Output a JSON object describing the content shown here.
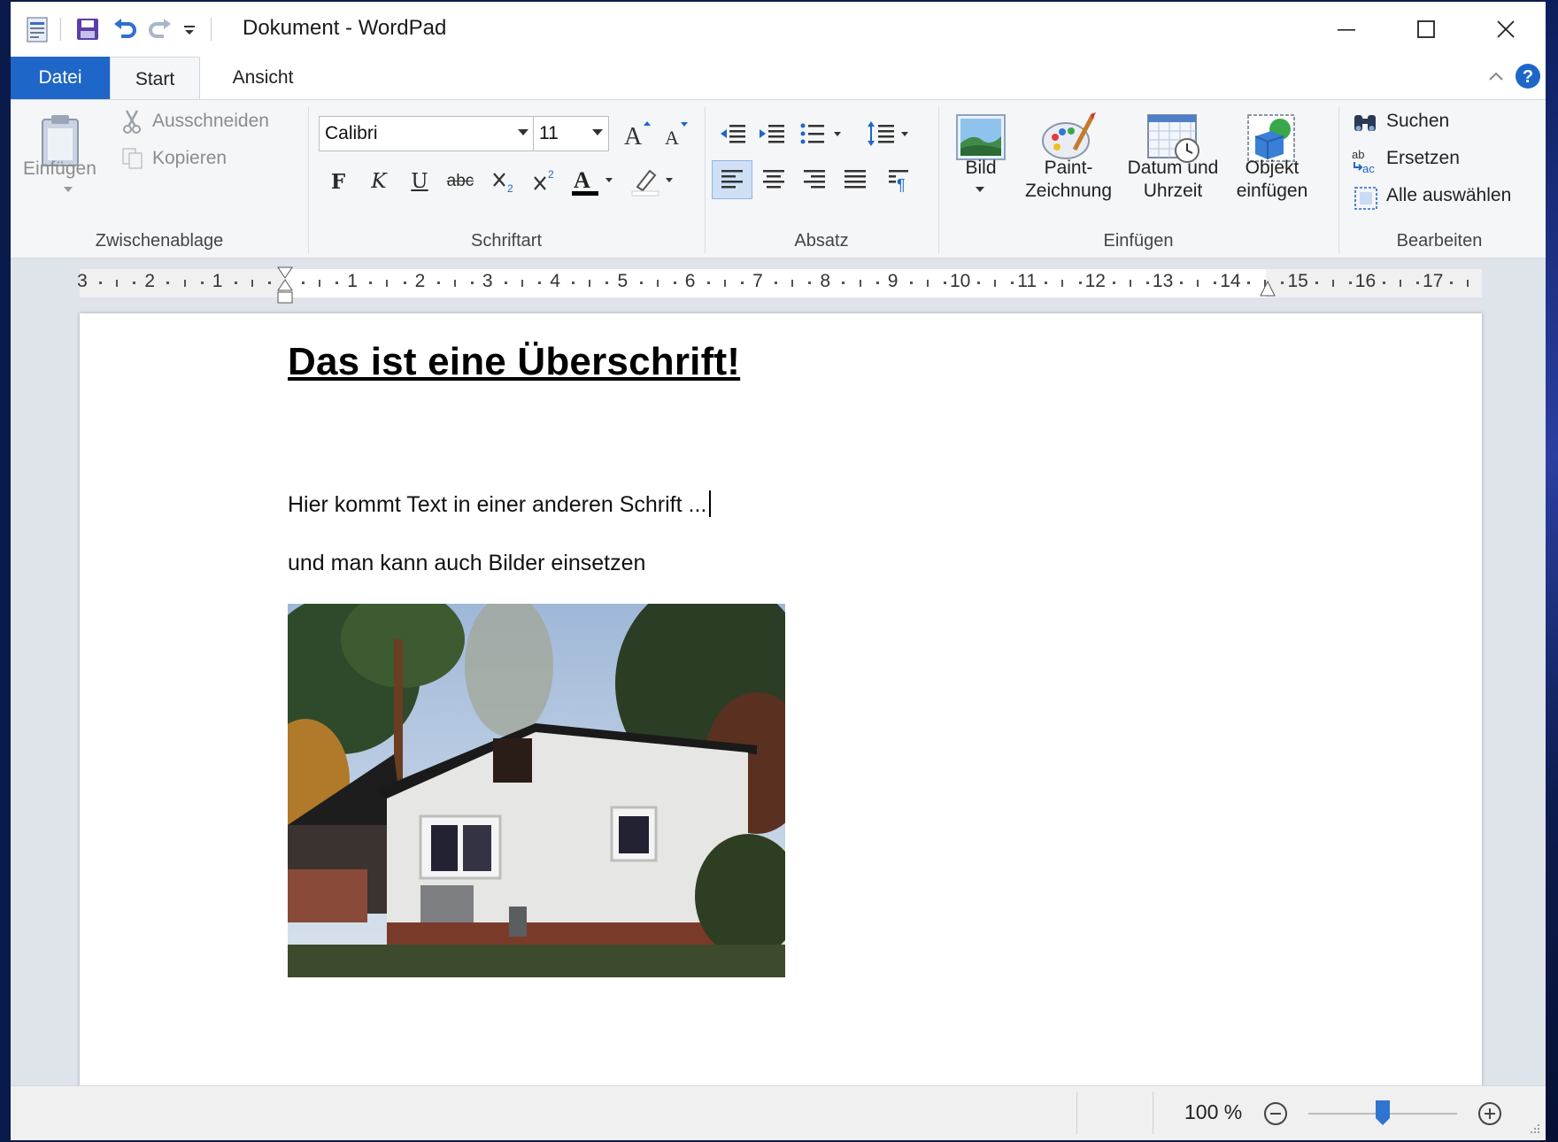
{
  "window": {
    "title": "Dokument - WordPad"
  },
  "tabs": {
    "file": "Datei",
    "start": "Start",
    "view": "Ansicht"
  },
  "clipboard": {
    "paste": "Einfügen",
    "cut": "Ausschneiden",
    "copy": "Kopieren",
    "group_label": "Zwischenablage"
  },
  "font": {
    "family": "Calibri",
    "size": "11",
    "group_label": "Schriftart",
    "bold": "F",
    "italic": "K",
    "underline": "U",
    "strike": "abc"
  },
  "paragraph": {
    "group_label": "Absatz"
  },
  "insert": {
    "picture": "Bild",
    "paint_line1": "Paint-",
    "paint_line2": "Zeichnung",
    "datetime_line1": "Datum und",
    "datetime_line2": "Uhrzeit",
    "object_line1": "Objekt",
    "object_line2": "einfügen",
    "group_label": "Einfügen"
  },
  "editing": {
    "find": "Suchen",
    "replace": "Ersetzen",
    "select_all": "Alle auswählen",
    "group_label": "Bearbeiten"
  },
  "ruler": {
    "numbers": [
      "3",
      "2",
      "1",
      "1",
      "2",
      "3",
      "4",
      "5",
      "6",
      "7",
      "8",
      "9",
      "10",
      "11",
      "12",
      "13",
      "14",
      "15",
      "16",
      "17"
    ]
  },
  "document": {
    "heading": "Das ist eine Überschrift!",
    "line1": "Hier kommt Text in einer anderen Schrift ...",
    "line2": "und man kann auch Bilder einsetzen"
  },
  "status": {
    "zoom_percent": "100 %",
    "zoom_level": 0.5
  },
  "colors": {
    "accent": "#1e66c8",
    "font_color": "#000000",
    "highlight": "#ffffff"
  }
}
